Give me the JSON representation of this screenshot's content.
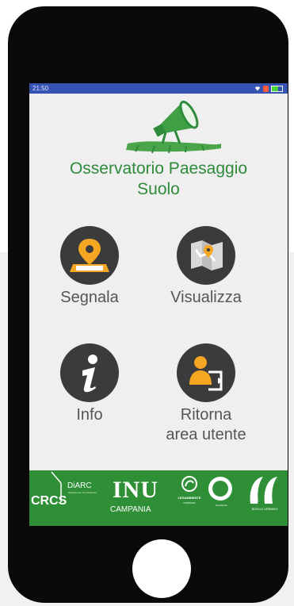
{
  "status_bar": {
    "time": "21:50"
  },
  "app": {
    "title_line1": "Osservatorio Paesaggio",
    "title_line2": "Suolo"
  },
  "menu": {
    "segnala": "Segnala",
    "visualizza": "Visualizza",
    "info": "Info",
    "ritorna_line1": "Ritorna",
    "ritorna_line2": "area utente"
  },
  "footer": {
    "crcs": "CRCS",
    "diarc": "DiARC",
    "diarc_sub": "Dipartimento di Architettura",
    "inu": "INU",
    "inu_sub": "CAMPANIA",
    "legambiente": "LEGAMBIENTE",
    "legambiente_sub": "CAMPANIA",
    "seal_text": "Accademia",
    "rf_text": "BOSCO URBANO"
  },
  "colors": {
    "status_bar": "#3652b2",
    "title_green": "#2e8b3c",
    "footer_green": "#2f8f36",
    "icon_circle": "#3b3b3b",
    "icon_orange": "#f5a623"
  }
}
